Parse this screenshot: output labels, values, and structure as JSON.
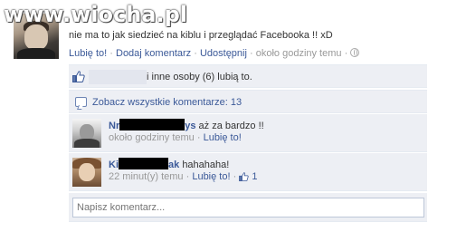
{
  "watermark": {
    "text": "www.wiocha.pl"
  },
  "post": {
    "text": "nie ma to jak siedzieć na kiblu i przeglądać Facebooka !! xD",
    "actions": {
      "like": "Lubię to!",
      "comment": "Dodaj komentarz",
      "share": "Udostępnij",
      "time": "około godziny temu",
      "separator": "·"
    }
  },
  "likes": {
    "text": "i inne osoby (6) lubią to."
  },
  "view_all": {
    "text": "Zobacz wszystkie komentarze: 13"
  },
  "comments": [
    {
      "name_start": "Nr",
      "name_end": "ys",
      "body": "aż za bardzo !!",
      "time": "około godziny temu",
      "like": "Lubię to!"
    },
    {
      "name_start": "Ki",
      "name_end": "ak",
      "body": "hahahaha!",
      "time": "22 minut(y) temu",
      "like": "Lubię to!",
      "like_count": "1"
    }
  ],
  "comment_input": {
    "placeholder": "Napisz komentarz..."
  },
  "colors": {
    "link": "#3b5998",
    "ufi_bg": "#edeff4",
    "muted": "#999999"
  }
}
